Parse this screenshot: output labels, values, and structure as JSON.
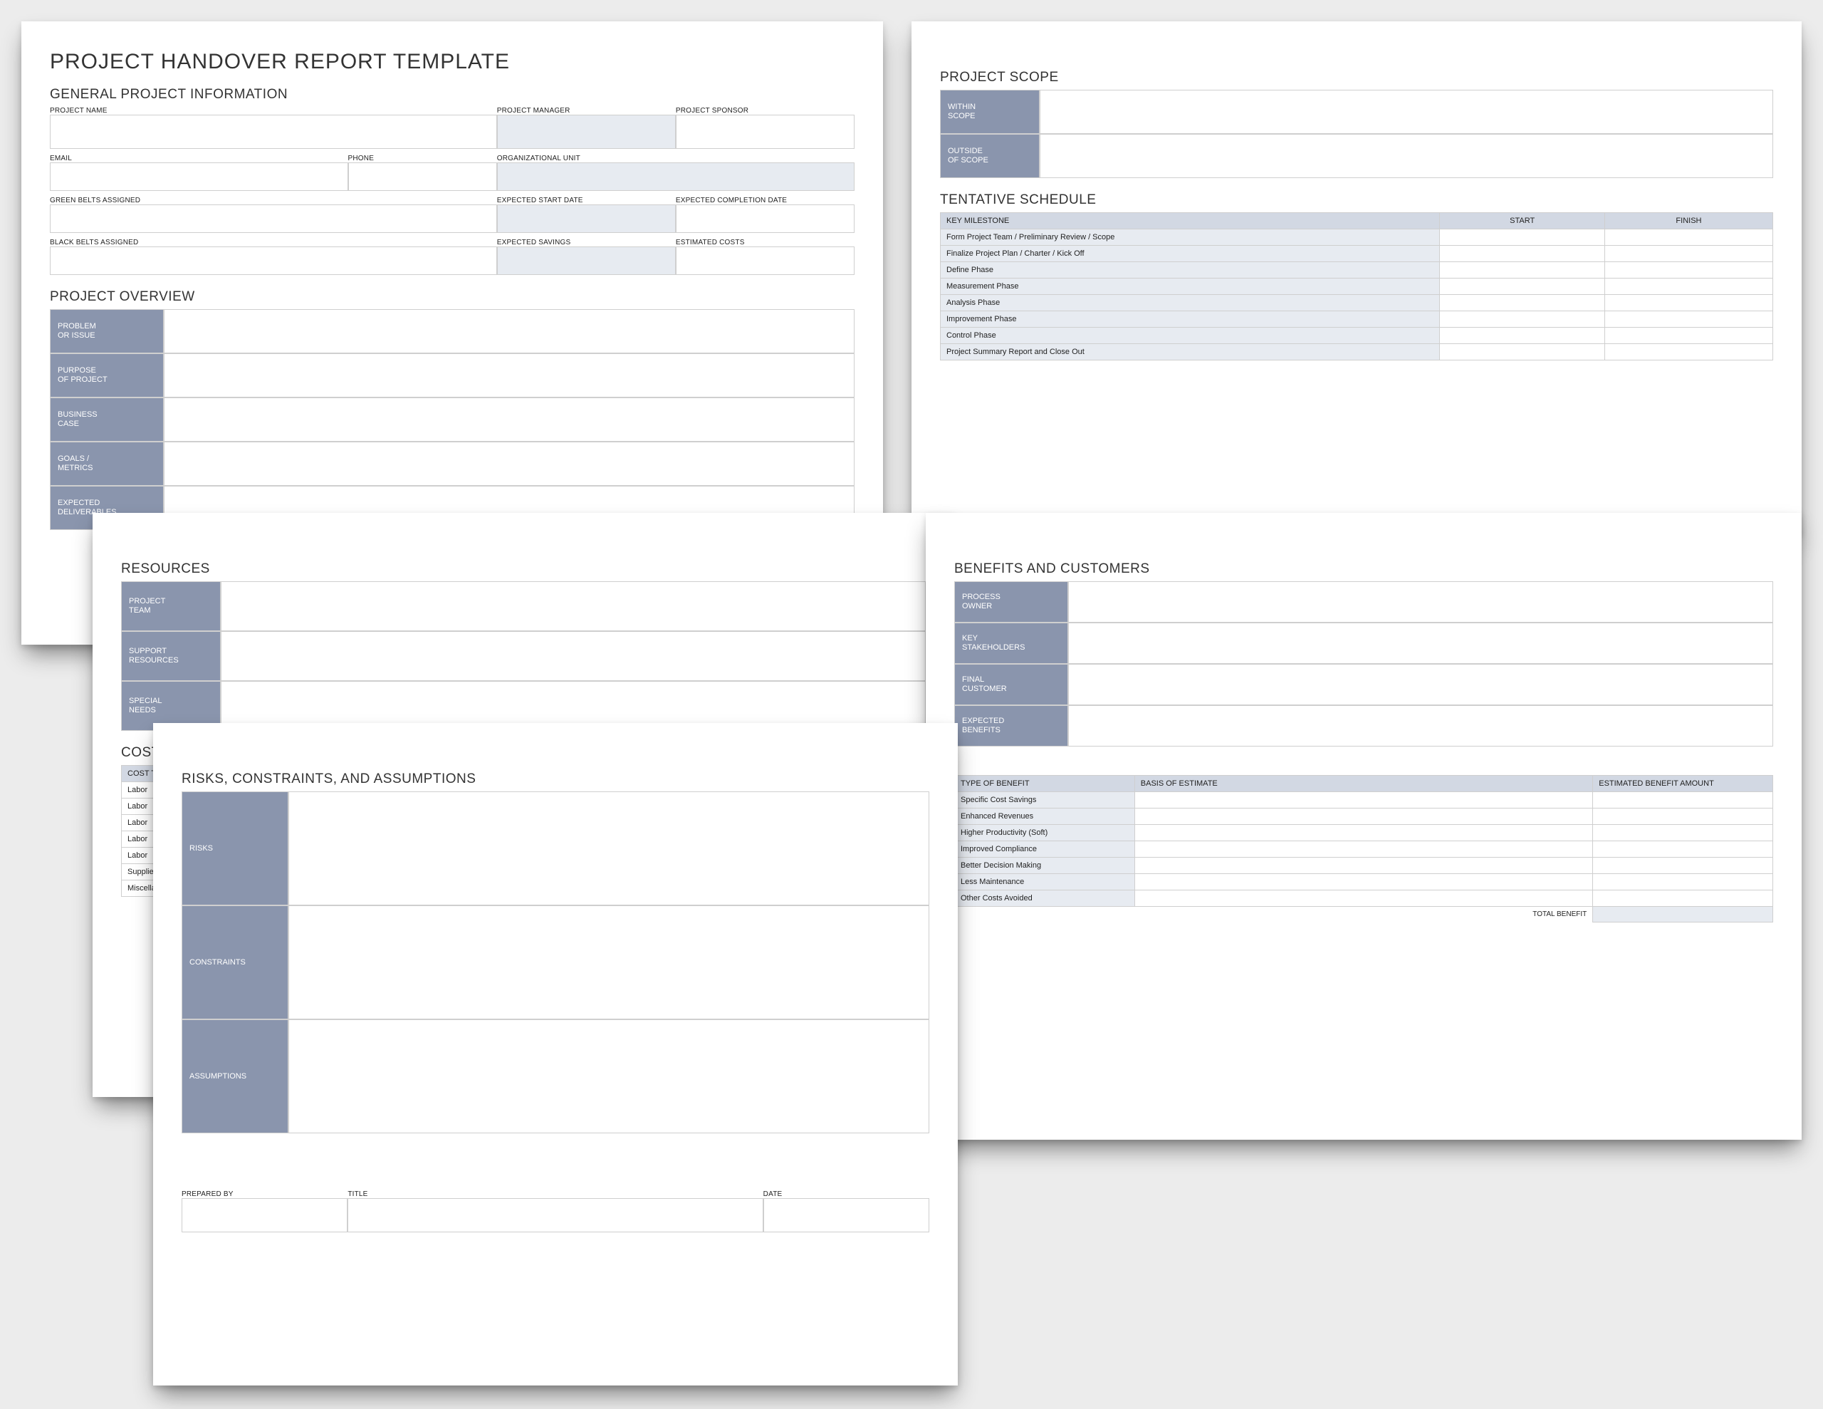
{
  "main_title": "PROJECT HANDOVER REPORT TEMPLATE",
  "general": {
    "title": "GENERAL PROJECT INFORMATION",
    "labels": {
      "project_name": "PROJECT NAME",
      "project_manager": "PROJECT MANAGER",
      "project_sponsor": "PROJECT SPONSOR",
      "email": "EMAIL",
      "phone": "PHONE",
      "org_unit": "ORGANIZATIONAL UNIT",
      "green_belts": "GREEN BELTS ASSIGNED",
      "expected_start": "EXPECTED START DATE",
      "expected_completion": "EXPECTED COMPLETION DATE",
      "black_belts": "BLACK BELTS ASSIGNED",
      "expected_savings": "EXPECTED SAVINGS",
      "estimated_costs": "ESTIMATED COSTS"
    }
  },
  "overview": {
    "title": "PROJECT OVERVIEW",
    "rows": {
      "r0": "PROBLEM\nOR ISSUE",
      "r1": "PURPOSE\nOF PROJECT",
      "r2": "BUSINESS\nCASE",
      "r3": "GOALS /\nMETRICS",
      "r4": "EXPECTED\nDELIVERABLES"
    }
  },
  "scope": {
    "title": "PROJECT SCOPE",
    "rows": {
      "r0": "WITHIN\nSCOPE",
      "r1": "OUTSIDE\nOF SCOPE"
    }
  },
  "schedule": {
    "title": "TENTATIVE SCHEDULE",
    "headers": {
      "milestone": "KEY MILESTONE",
      "start": "START",
      "finish": "FINISH"
    },
    "rows": {
      "r0": "Form Project Team / Preliminary Review / Scope",
      "r1": "Finalize Project Plan / Charter / Kick Off",
      "r2": "Define Phase",
      "r3": "Measurement Phase",
      "r4": "Analysis Phase",
      "r5": "Improvement Phase",
      "r6": "Control Phase",
      "r7": "Project Summary Report and Close Out"
    }
  },
  "resources": {
    "title": "RESOURCES",
    "rows": {
      "r0": "PROJECT\nTEAM",
      "r1": "SUPPORT\nRESOURCES",
      "r2": "SPECIAL\nNEEDS"
    }
  },
  "costs": {
    "title": "COSTS",
    "headers": {
      "type": "COST TYPE"
    },
    "rows": {
      "r0": "Labor",
      "r1": "Labor",
      "r2": "Labor",
      "r3": "Labor",
      "r4": "Labor",
      "r5": "Supplies",
      "r6": "Miscellaneous"
    }
  },
  "benefits": {
    "title": "BENEFITS AND CUSTOMERS",
    "rows": {
      "r0": "PROCESS\nOWNER",
      "r1": "KEY\nSTAKEHOLDERS",
      "r2": "FINAL\nCUSTOMER",
      "r3": "EXPECTED\nBENEFITS"
    }
  },
  "benefit_table": {
    "headers": {
      "type": "TYPE OF BENEFIT",
      "basis": "BASIS OF ESTIMATE",
      "amount": "ESTIMATED BENEFIT AMOUNT"
    },
    "rows": {
      "r0": "Specific Cost Savings",
      "r1": "Enhanced Revenues",
      "r2": "Higher Productivity (Soft)",
      "r3": "Improved Compliance",
      "r4": "Better Decision Making",
      "r5": "Less Maintenance",
      "r6": "Other Costs Avoided"
    },
    "total_label": "TOTAL BENEFIT"
  },
  "risks": {
    "title": "RISKS, CONSTRAINTS, AND ASSUMPTIONS",
    "rows": {
      "r0": "RISKS",
      "r1": "CONSTRAINTS",
      "r2": "ASSUMPTIONS"
    }
  },
  "signoff": {
    "prepared_by": "PREPARED BY",
    "title": "TITLE",
    "date": "DATE"
  }
}
